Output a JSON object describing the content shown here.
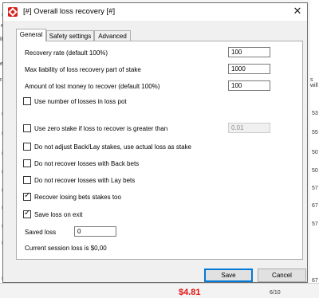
{
  "background": {
    "left_fragments": [
      "e",
      "ithe",
      "e is",
      "rate"
    ],
    "right_numbers": [
      "53",
      "55",
      "50",
      "50",
      "57",
      "67",
      "57",
      "67"
    ],
    "right_fragment": "s will",
    "bottom_amount": "$4.81",
    "bottom_right_text": "6/10",
    "bottom_right_num": "67"
  },
  "dialog": {
    "title": "[#] Overall loss recovery [#]",
    "tabs": [
      "General",
      "Safety settings",
      "Advanced"
    ],
    "fields": {
      "recovery_rate_label": "Recovery rate (default 100%)",
      "recovery_rate_value": "100",
      "max_liability_label": "Max liability of loss recovery part of stake",
      "max_liability_value": "1000",
      "amount_lost_label": "Amount of lost money to recover (default 100%)",
      "amount_lost_value": "100",
      "zero_stake_value": "0.01",
      "saved_loss_label": "Saved loss",
      "saved_loss_value": "0"
    },
    "checkboxes": [
      {
        "label": "Use number of losses in loss pot",
        "checked": false
      },
      {
        "label": "Use zero stake if loss to recover is greater than",
        "checked": false
      },
      {
        "label": "Do not adjust Back/Lay stakes, use actual loss as stake",
        "checked": false
      },
      {
        "label": "Do not recover losses with Back bets",
        "checked": false
      },
      {
        "label": "Do not recover losses with Lay bets",
        "checked": false
      },
      {
        "label": "Recover losing bets stakes too",
        "checked": true
      },
      {
        "label": "Save loss on exit",
        "checked": true
      }
    ],
    "session_text": "Current session loss is $0,00",
    "buttons": {
      "save": "Save",
      "cancel": "Cancel"
    },
    "check_mark": "✓",
    "close_glyph": "✕"
  }
}
